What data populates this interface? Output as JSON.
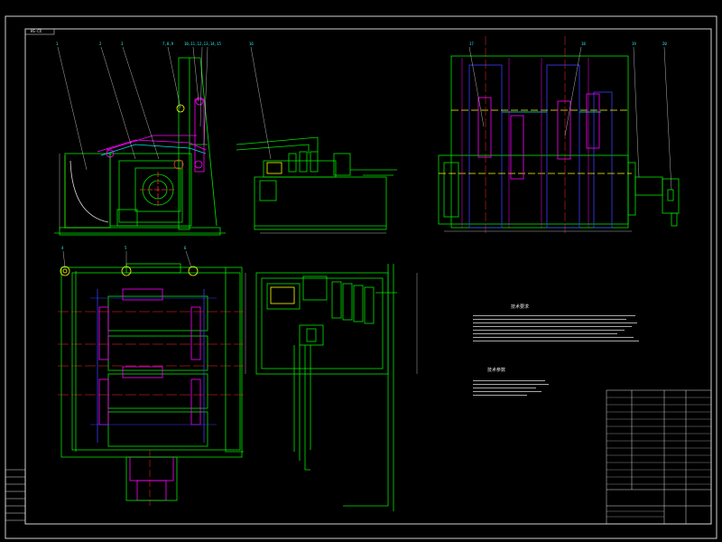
{
  "drawing": {
    "background": "#000000",
    "frame_color": "#e0e0e0",
    "title_tag": "HS-CX",
    "colors": {
      "green": "#00e600",
      "magenta": "#ff00ff",
      "red": "#ff2a2a",
      "yellow": "#ffff00",
      "cyan": "#00e5e5",
      "blue": "#3b3bff",
      "white": "#ffffff"
    },
    "views": [
      "side-view",
      "hydraulic-station-front",
      "rear-view",
      "plan-view",
      "hydraulic-station-plan"
    ],
    "callout_numbers": [
      "1",
      "2",
      "3",
      "7,8,9",
      "10,11,12,13,14,15",
      "16",
      "17",
      "18",
      "19",
      "20",
      "4",
      "5",
      "6"
    ],
    "notes": {
      "heading": "技术要求",
      "lines": [
        "",
        "",
        "",
        "",
        "",
        "",
        "",
        "",
        "",
        "",
        ""
      ]
    },
    "specs": {
      "heading": "技术参数",
      "lines": [
        "",
        "",
        "",
        "",
        "",
        ""
      ]
    },
    "title_block": {
      "drawing_name": "",
      "company": "",
      "drawing_no": ""
    }
  }
}
